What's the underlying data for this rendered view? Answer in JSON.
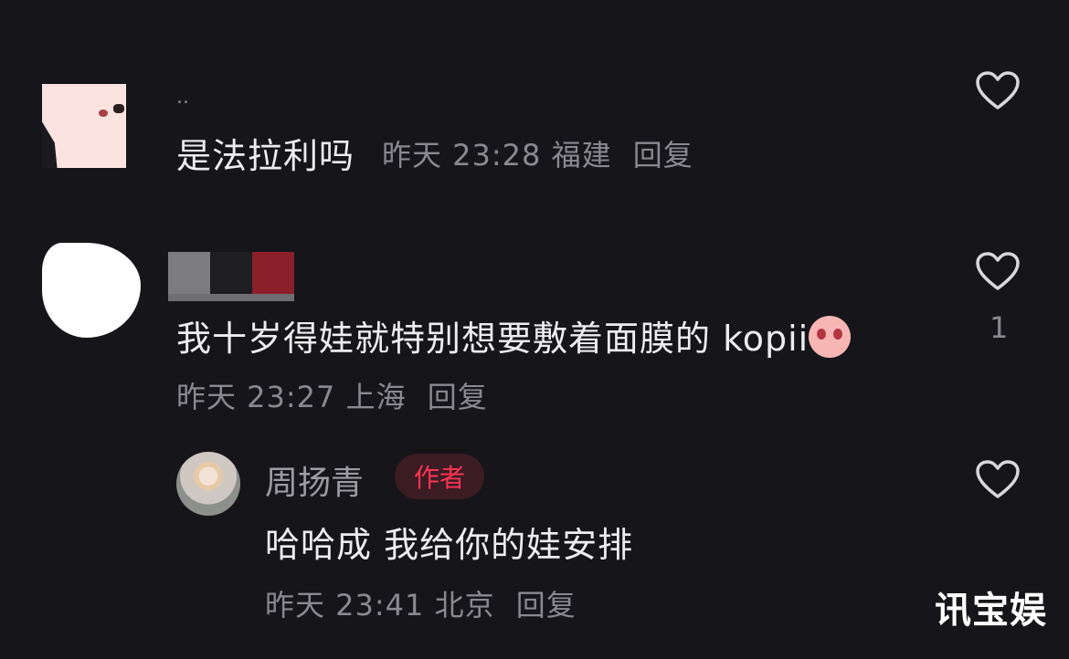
{
  "comments": [
    {
      "username": "..",
      "text": "是法拉利吗",
      "time": "昨天 23:28",
      "location": "福建",
      "reply_label": "回复",
      "likes": ""
    },
    {
      "username": "",
      "text": "我十岁得娃就特别想要敷着面膜的 kopii",
      "time": "昨天 23:27",
      "location": "上海",
      "reply_label": "回复",
      "likes": "1",
      "replies": [
        {
          "username": "周扬青",
          "badge": "作者",
          "text": "哈哈成 我给你的娃安排",
          "time": "昨天 23:41",
          "location": "北京",
          "reply_label": "回复"
        }
      ]
    }
  ],
  "watermark": "讯宝娱",
  "colors": {
    "background": "#161519",
    "author_badge": "#ff3355",
    "author_badge_bg": "#3a1c22",
    "meta_text": "#8a898f"
  },
  "icons": [
    "heart-outline-icon",
    "crying-face-emoji"
  ]
}
